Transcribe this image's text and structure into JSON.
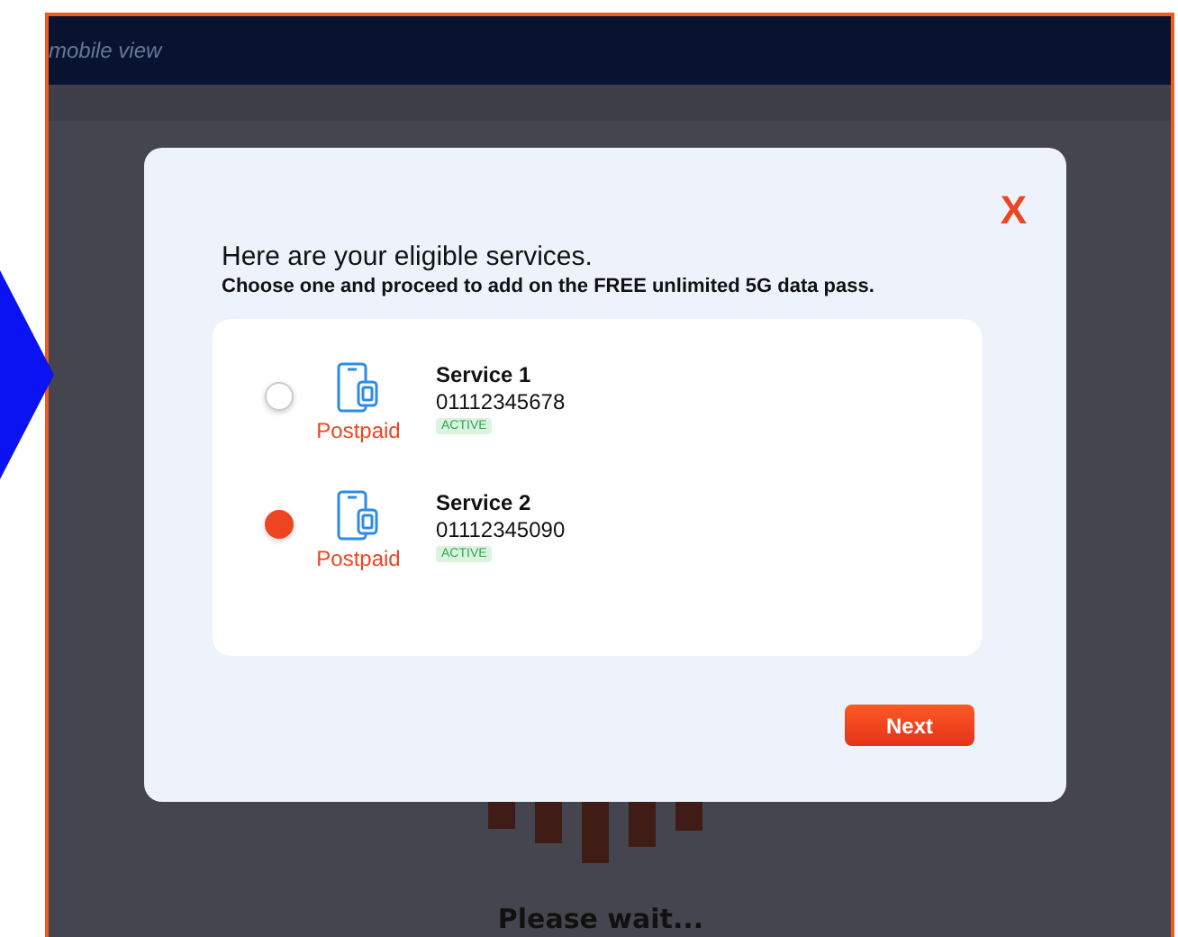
{
  "header": {
    "title": "mobile view"
  },
  "dialog": {
    "close": "X",
    "title": "Here are your eligible services.",
    "subtitle": "Choose one and proceed to add on the FREE unlimited 5G data pass.",
    "services": [
      {
        "selected": false,
        "plan": "Postpaid",
        "name": "Service 1",
        "number": "01112345678",
        "status": "ACTIVE"
      },
      {
        "selected": true,
        "plan": "Postpaid",
        "name": "Service 2",
        "number": "01112345090",
        "status": "ACTIVE"
      }
    ],
    "next_button": "Next"
  },
  "loading": {
    "message": "Please wait..."
  }
}
